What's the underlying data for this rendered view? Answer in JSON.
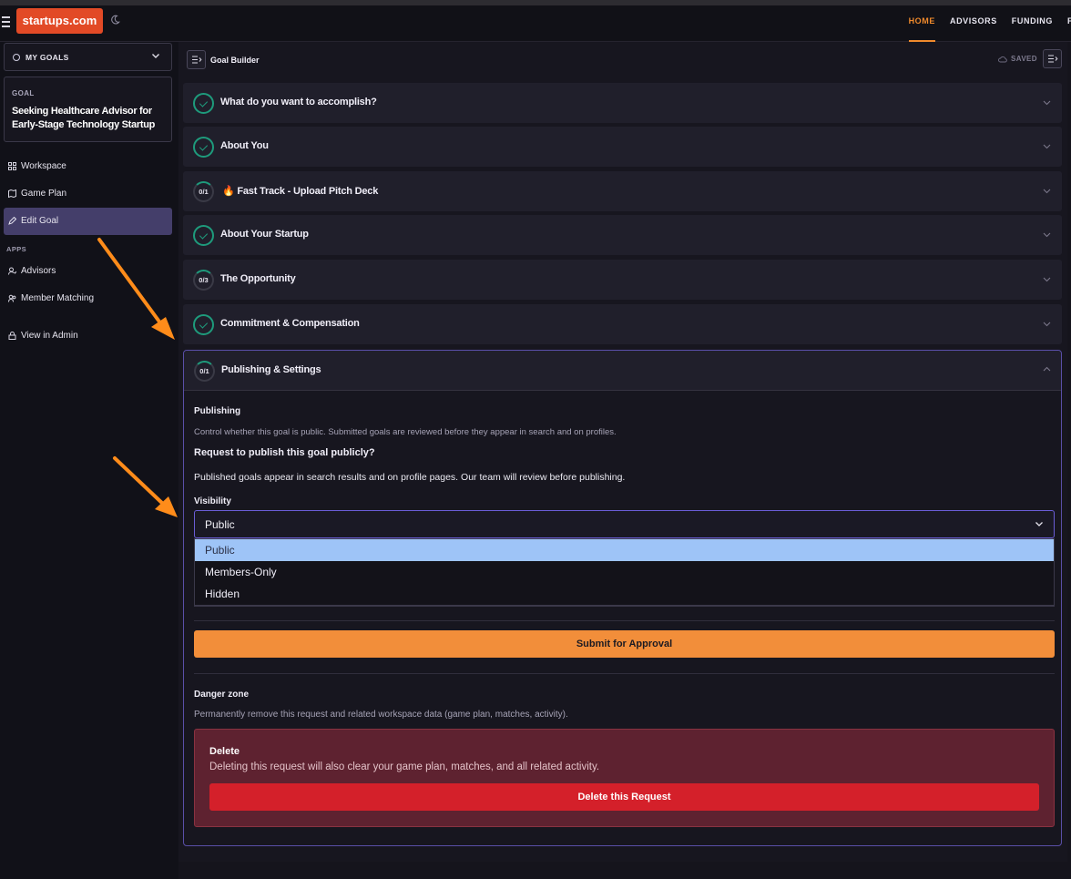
{
  "header": {
    "logo": "startups.com",
    "nav": [
      {
        "label": "HOME",
        "active": true
      },
      {
        "label": "ADVISORS",
        "active": false
      },
      {
        "label": "FUNDING",
        "active": false
      },
      {
        "label": "F",
        "active": false
      }
    ]
  },
  "sidebar": {
    "goals_dropdown": "MY GOALS",
    "goal_caption": "GOAL",
    "goal_title": "Seeking Healthcare Advisor for Early-Stage Technology Startup",
    "items": [
      {
        "label": "Workspace",
        "icon": "grid-icon"
      },
      {
        "label": "Game Plan",
        "icon": "map-icon"
      },
      {
        "label": "Edit Goal",
        "icon": "pencil-icon",
        "active": true
      }
    ],
    "apps_caption": "APPS",
    "apps": [
      {
        "label": "Advisors",
        "icon": "advisor-icon"
      },
      {
        "label": "Member Matching",
        "icon": "users-icon"
      }
    ],
    "admin": {
      "label": "View in Admin",
      "icon": "lock-icon"
    }
  },
  "builder": {
    "title": "Goal Builder",
    "saved_label": "SAVED",
    "sections": [
      {
        "title": "What do you want to accomplish?",
        "status": "complete"
      },
      {
        "title": "About You",
        "status": "complete"
      },
      {
        "title": "🔥 Fast Track - Upload Pitch Deck",
        "status": "partial",
        "progress": "0/1"
      },
      {
        "title": "About Your Startup",
        "status": "complete"
      },
      {
        "title": "The Opportunity",
        "status": "partial",
        "progress": "0/3"
      },
      {
        "title": "Commitment & Compensation",
        "status": "complete"
      }
    ],
    "expanded": {
      "title": "Publishing & Settings",
      "progress": "0/1",
      "publishing_heading": "Publishing",
      "publishing_desc": "Control whether this goal is public. Submitted goals are reviewed before they appear in search and on profiles.",
      "request_heading": "Request to publish this goal publicly?",
      "request_desc": "Published goals appear in search results and on profile pages. Our team will review before publishing.",
      "visibility_label": "Visibility",
      "visibility_value": "Public",
      "visibility_options": [
        "Public",
        "Members-Only",
        "Hidden"
      ],
      "submit_label": "Submit for Approval",
      "danger_heading": "Danger zone",
      "danger_desc": "Permanently remove this request and related workspace data (game plan, matches, activity).",
      "delete_heading": "Delete",
      "delete_desc": "Deleting this request will also clear your game plan, matches, and all related activity.",
      "delete_button": "Delete this Request"
    }
  },
  "colors": {
    "accent_orange": "#f08a2c",
    "brand_red": "#e24a26",
    "success_green": "#1e9b7c",
    "focus_purple": "#6a5dd6",
    "danger_red": "#d4202a",
    "annotation_arrow": "#ff8c1a"
  }
}
